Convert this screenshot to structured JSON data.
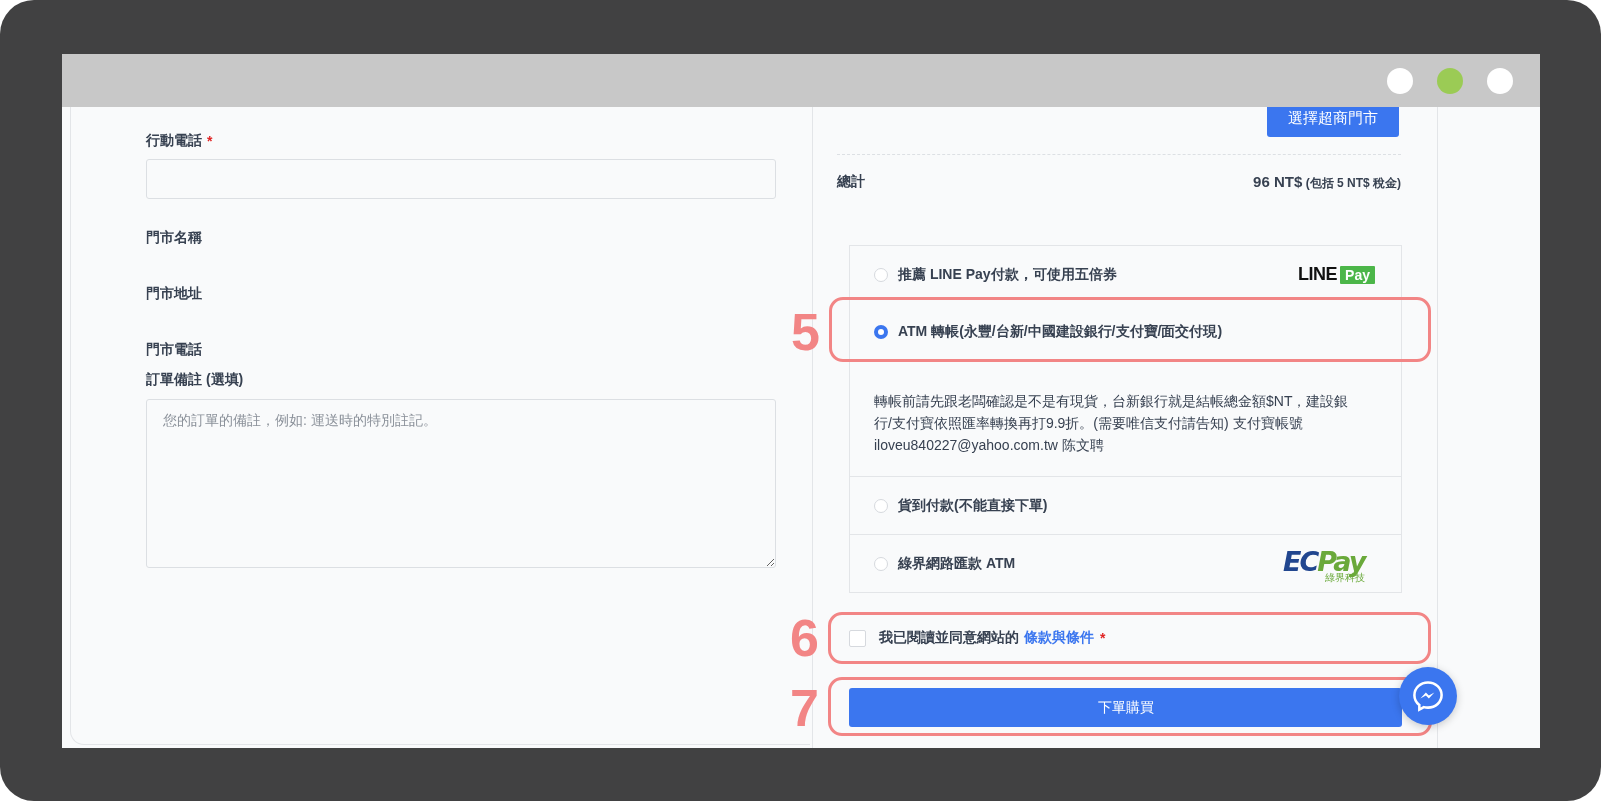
{
  "window": {
    "controls": [
      {
        "color": "#ffffff"
      },
      {
        "color": "#9bcb55"
      },
      {
        "color": "#ffffff"
      }
    ]
  },
  "form": {
    "fields": [
      {
        "kind": "input",
        "label": "行動電話",
        "required_mark": "*"
      },
      {
        "kind": "info",
        "label": "門市名稱"
      },
      {
        "kind": "info",
        "label": "門市地址"
      },
      {
        "kind": "info",
        "label": "門市電話"
      },
      {
        "kind": "textarea",
        "label": "訂單備註 (選填)",
        "placeholder": "您的訂單的備註，例如: 運送時的特別註記。"
      }
    ]
  },
  "store": {
    "button": "選擇超商門市"
  },
  "total": {
    "label": "總計",
    "amount": "96 NT$",
    "tax_note": "(包括 5 NT$ 稅金)"
  },
  "payment_methods": [
    {
      "label": "推薦 LINE Pay付款，可使用五倍券",
      "selected": false,
      "logo": {
        "kind": "linepay",
        "text": "LINE",
        "badge": "Pay"
      }
    },
    {
      "label": "ATM 轉帳(永豐/台新/中國建設銀行/支付寶/面交付現)",
      "selected": true,
      "annotation": "5",
      "description": "轉帳前請先跟老闆確認是不是有現貨，台新銀行就是結帳總金額$NT，建設銀行/支付寶依照匯率轉換再打9.9折。(需要唯信支付請告知) 支付寶帳號 iloveu840227@yahoo.com.tw 陈文聘"
    },
    {
      "label": "貨到付款(不能直接下單)",
      "selected": false
    },
    {
      "label": "綠界網路匯款 ATM",
      "selected": false,
      "logo": {
        "kind": "ecpay",
        "text": "EC",
        "badge": "Pay",
        "caption": "綠界科技"
      }
    }
  ],
  "terms": {
    "checked": false,
    "text": "我已閱讀並同意網站的",
    "link": "條款與條件",
    "required_mark": "*",
    "annotation": "6"
  },
  "submit": {
    "label": "下單購買",
    "annotation": "7"
  }
}
